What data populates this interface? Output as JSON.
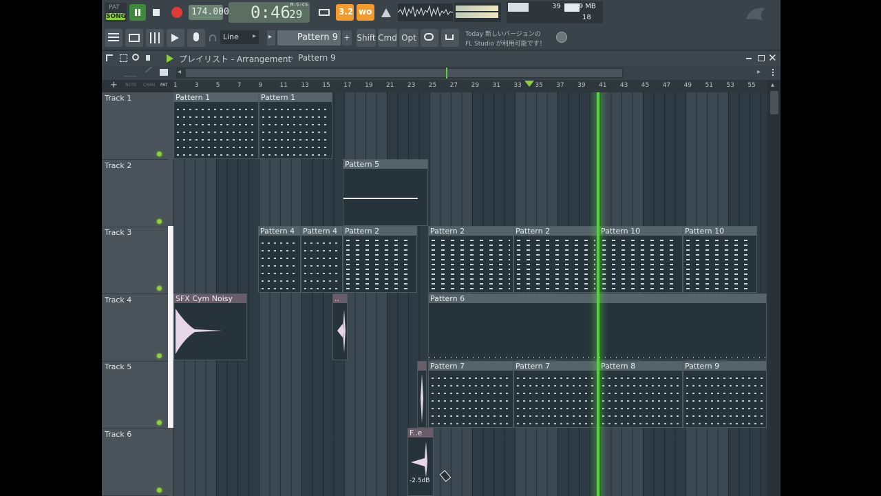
{
  "toolbar": {
    "pat_label": "PAT",
    "song_label": "SONG",
    "tempo": "174.000",
    "time_main": "0:46",
    "time_sub": "29",
    "time_format": "M:S:CS",
    "cpu_value": "39",
    "memory": "319 MB",
    "poly_value": "18",
    "snap_mode": "Line",
    "pattern_name": "Pattern 9",
    "shift_label": "Shift",
    "cmd_label": "Cmd",
    "opt_label": "Opt",
    "news_line1": "Today  新しいバージョンの",
    "news_line2": "FL Studio が利用可能です！",
    "accent_color": "#f39c2c",
    "record_color": "#e23a3a"
  },
  "playlist": {
    "title_prefix": "プレイリスト - Arrangement",
    "title_sep": "›",
    "title_pattern": "Pattern 9",
    "mini_labels": [
      "NOTE",
      "CHAN",
      "PAT"
    ],
    "ruler_ticks": [
      "1",
      "3",
      "5",
      "7",
      "9",
      "11",
      "13",
      "15",
      "17",
      "19",
      "21",
      "23",
      "25",
      "27",
      "29",
      "31",
      "33",
      "35",
      "37",
      "39",
      "41",
      "43",
      "45",
      "47",
      "49",
      "51",
      "53",
      "55"
    ],
    "tracks": [
      "Track 1",
      "Track 2",
      "Track 3",
      "Track 4",
      "Track 5",
      "Track 6"
    ],
    "clips": {
      "t1a": "Pattern 1",
      "t1b": "Pattern 1",
      "t2a": "Pattern 5",
      "t3a": "Pattern 4",
      "t3b": "Pattern 4",
      "t3c": "Pattern 2",
      "t3d": "Pattern 2",
      "t3e": "Pattern 2",
      "t3f": "Pattern 10",
      "t3g": "Pattern 10",
      "t4a": "SFX Cym Noisy",
      "t4b": "..",
      "t4c": "Pattern 6",
      "t5a": "Pattern 7",
      "t5b": "Pattern 7",
      "t5c": "Pattern 8",
      "t5d": "Pattern 9",
      "t6a": "F..e",
      "t6_gain": "-2.5dB"
    },
    "playhead_color": "#58d23a"
  }
}
